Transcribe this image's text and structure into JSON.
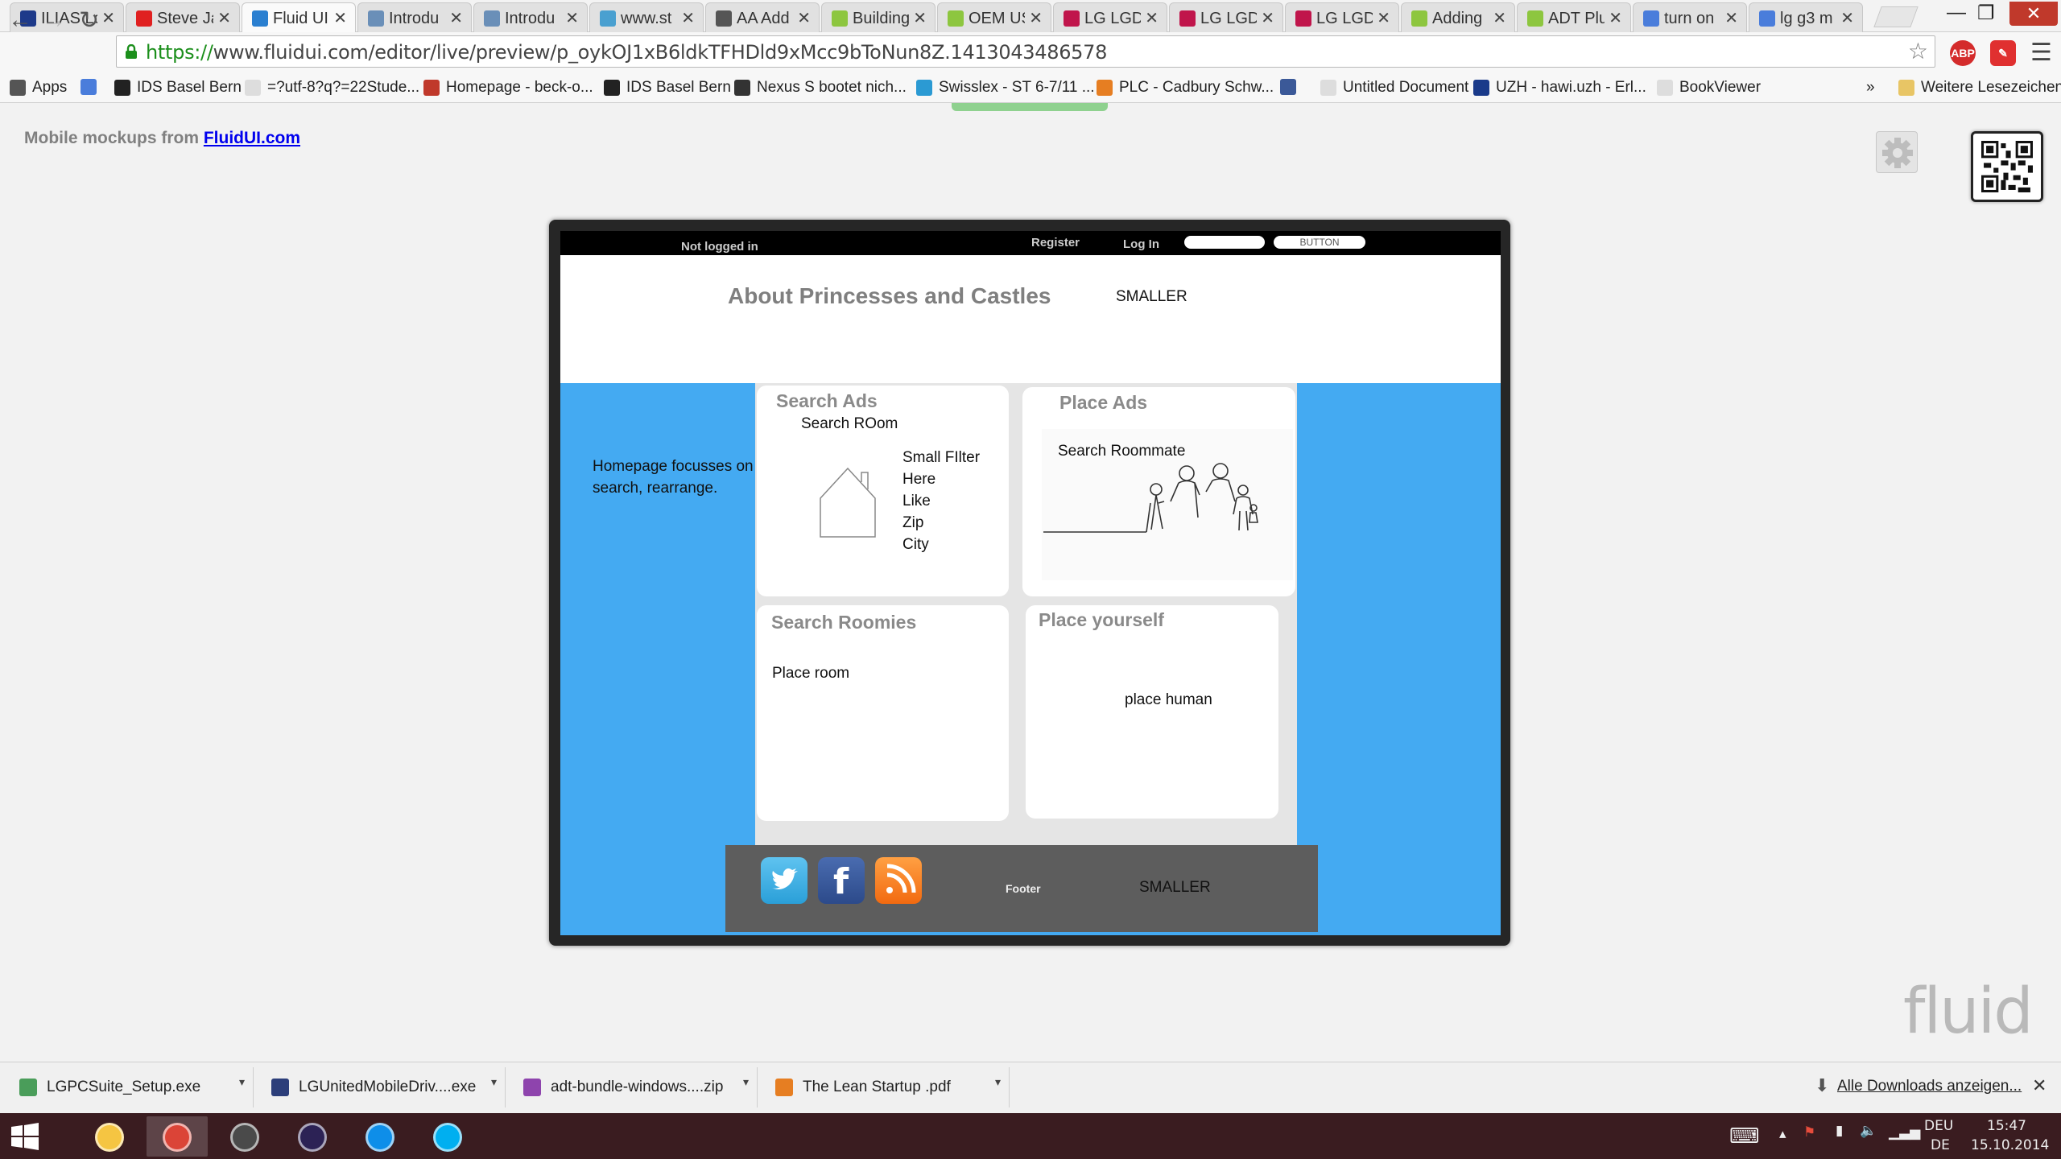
{
  "browser": {
    "tabs": [
      {
        "label": "ILIAS Lo",
        "color": "#1e3a8a"
      },
      {
        "label": "Steve Ja",
        "color": "#e02020"
      },
      {
        "label": "Fluid UI",
        "color": "#2a7fd0"
      },
      {
        "label": "Introdu",
        "color": "#6a8fb8"
      },
      {
        "label": "Introdu",
        "color": "#6a8fb8"
      },
      {
        "label": "www.st",
        "color": "#4aa0d0"
      },
      {
        "label": "AA Add",
        "color": "#555555"
      },
      {
        "label": "Building",
        "color": "#8dc63f"
      },
      {
        "label": "OEM US",
        "color": "#8dc63f"
      },
      {
        "label": "LG LGD",
        "color": "#c0154b"
      },
      {
        "label": "LG LGD",
        "color": "#c0154b"
      },
      {
        "label": "LG LGD",
        "color": "#c0154b"
      },
      {
        "label": "Adding",
        "color": "#8dc63f"
      },
      {
        "label": "ADT Plu",
        "color": "#8dc63f"
      },
      {
        "label": "turn on",
        "color": "#4a7ddb"
      },
      {
        "label": "lg g3 m",
        "color": "#4a7ddb"
      }
    ],
    "tab_close_glyph": "✕",
    "url_scheme": "https://",
    "url_rest": "www.fluidui.com/editor/live/preview/p_oykOJ1xB6ldkTFHDld9xMcc9bToNun8Z.1413043486578",
    "extensions": {
      "abp": "ABP"
    },
    "bookmarks": [
      {
        "label": "Apps",
        "color": "#555555"
      },
      {
        "label": "",
        "color": "#4a7ddb"
      },
      {
        "label": "IDS Basel Bern",
        "color": "#222222"
      },
      {
        "label": "=?utf-8?q?=22Stude...",
        "color": "#dddddd"
      },
      {
        "label": "Homepage - beck-o...",
        "color": "#c0392b"
      },
      {
        "label": "IDS Basel Bern",
        "color": "#222222"
      },
      {
        "label": "Nexus S bootet nich...",
        "color": "#333333"
      },
      {
        "label": "Swisslex - ST 6-7/11 ...",
        "color": "#2b9ad3"
      },
      {
        "label": "PLC - Cadbury Schw...",
        "color": "#e67e22"
      },
      {
        "label": "",
        "color": "#3b5998"
      },
      {
        "label": "Untitled Document",
        "color": "#dddddd"
      },
      {
        "label": "UZH - hawi.uzh - Erl...",
        "color": "#1a3a8a"
      },
      {
        "label": "BookViewer",
        "color": "#dddddd"
      }
    ],
    "bookmarks_more": "»",
    "other_bookmarks": "Weitere Lesezeichen"
  },
  "page": {
    "credit_prefix": "Mobile mockups from ",
    "credit_link": "FluidUI.com",
    "fluid_logo": "fluid"
  },
  "mockup": {
    "topbar": {
      "status": "Not logged in",
      "register": "Register",
      "login": "Log In",
      "button": "BUTTON"
    },
    "title": "About Princesses and Castles",
    "title_note": "SMALLER",
    "sidebar_note": "Homepage focusses on search, rearrange.",
    "cards": {
      "search_ads": {
        "title": "Search Ads",
        "subtitle": "Search ROom",
        "filter_lines": [
          "Small FIlter",
          "Here",
          "Like",
          "Zip",
          "City"
        ]
      },
      "place_ads": {
        "title": "Place Ads",
        "subtitle": "Search Roommate"
      },
      "search_roomies": {
        "title": "Search Roomies",
        "text": "Place room"
      },
      "place_yourself": {
        "title": "Place yourself",
        "text": "place human"
      }
    },
    "footer": {
      "label": "Footer",
      "note": "SMALLER",
      "social": [
        "twitter",
        "facebook",
        "rss"
      ]
    }
  },
  "downloads": {
    "items": [
      {
        "name": "LGPCSuite_Setup.exe",
        "color": "#4a9d5a"
      },
      {
        "name": "LGUnitedMobileDriv....exe",
        "color": "#2c3e7a"
      },
      {
        "name": "adt-bundle-windows....zip",
        "color": "#8e44ad"
      },
      {
        "name": "The Lean Startup .pdf",
        "color": "#e67e22"
      }
    ],
    "show_all": "Alle Downloads anzeigen...",
    "close": "✕"
  },
  "taskbar": {
    "apps": [
      {
        "name": "file-explorer",
        "color": "#f5c542"
      },
      {
        "name": "chrome",
        "color": "#db4437"
      },
      {
        "name": "sublime-text",
        "color": "#4a4a4a"
      },
      {
        "name": "eclipse",
        "color": "#2c2255"
      },
      {
        "name": "teamviewer",
        "color": "#0e8ee9"
      },
      {
        "name": "skype",
        "color": "#00aff0"
      }
    ],
    "lang_top": "DEU",
    "lang_bottom": "DE",
    "time": "15:47",
    "date": "15.10.2014"
  }
}
